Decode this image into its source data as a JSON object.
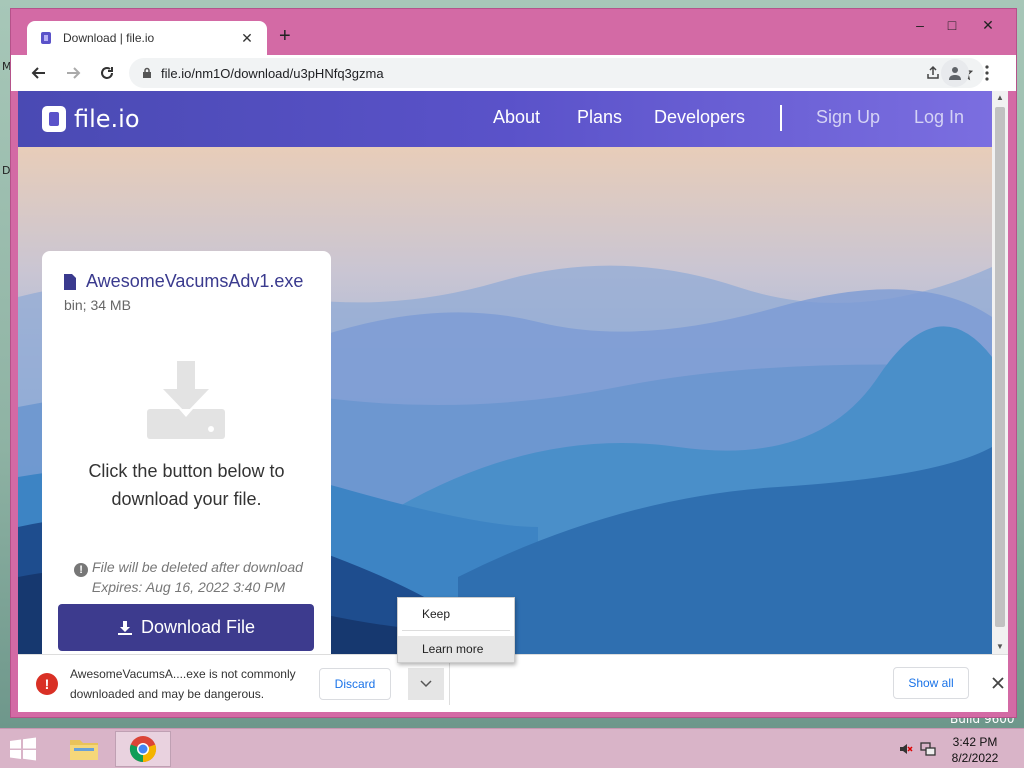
{
  "desktop": {
    "fragments": [
      "M",
      "D",
      "Build 9600",
      "D"
    ]
  },
  "browser": {
    "tab": {
      "title": "Download | file.io",
      "favicon": "file-io-favicon"
    },
    "new_tab_label": "+",
    "window_controls": {
      "minimize": "–",
      "maximize": "□",
      "close": "✕"
    },
    "address_bar": {
      "url": "file.io/nm1O/download/u3pHNfq3gzma"
    }
  },
  "site": {
    "logo_text": "file.io",
    "nav": {
      "about": "About",
      "plans": "Plans",
      "developers": "Developers",
      "sign_up": "Sign Up",
      "log_in": "Log In"
    },
    "card": {
      "file_name": "AwesomeVacumsAdv1.exe",
      "file_meta": "bin; 34 MB",
      "instruction": "Click the button below to download your file.",
      "warning": "File will be deleted after download",
      "expires": "Expires: Aug 16, 2022 3:40 PM",
      "download_button": "Download File"
    },
    "colors": {
      "header_start": "#4a4ab3",
      "header_end": "#7b6ee0",
      "button": "#3d3b8e"
    }
  },
  "context_menu": {
    "keep": "Keep",
    "learn_more": "Learn more"
  },
  "download_bar": {
    "message": "AwesomeVacumsA....exe is not commonly downloaded and may be dangerous.",
    "discard": "Discard",
    "show_all": "Show all"
  },
  "taskbar": {
    "time": "3:42 PM",
    "date": "8/2/2022"
  }
}
